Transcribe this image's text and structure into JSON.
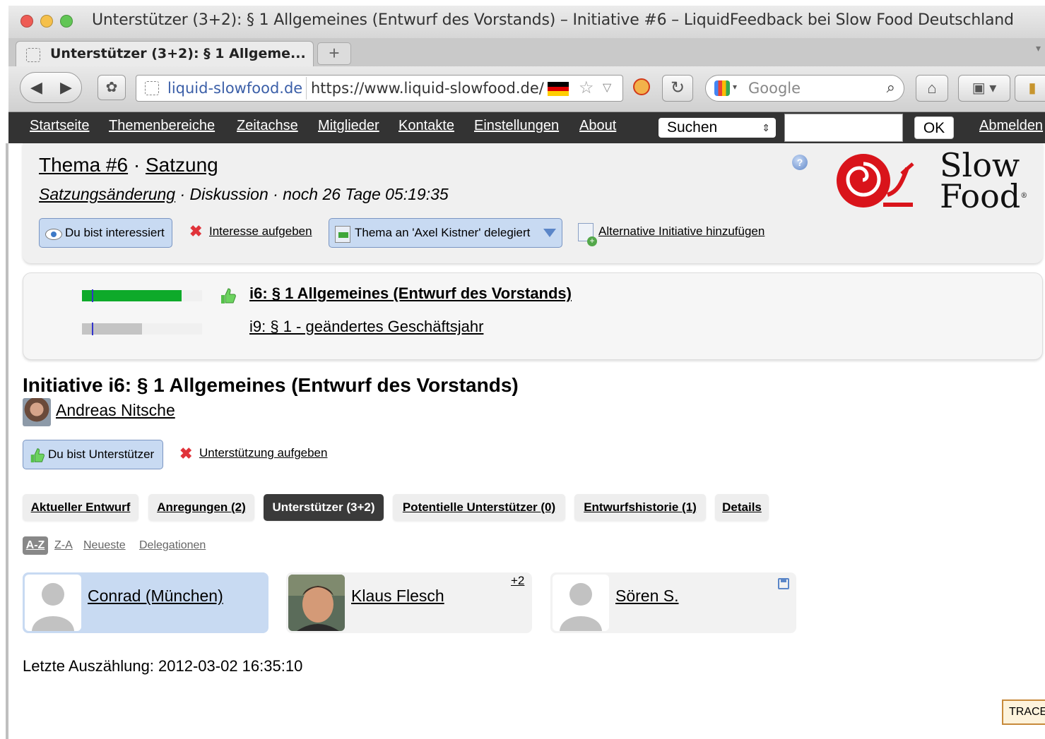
{
  "browser": {
    "window_title": "Unterstützer (3+2): § 1 Allgemeines (Entwurf des Vorstands) – Initiative #6 – LiquidFeedback bei Slow Food Deutschland",
    "tab_label": "Unterstützer (3+2): § 1 Allgeme...",
    "new_tab": "+",
    "url_host": "liquid-slowfood.de",
    "url_full": "https://www.liquid-slowfood.de/",
    "search_engine": "Google",
    "icons": [
      "back-icon",
      "forward-icon",
      "paw-icon",
      "star-icon",
      "noscript-icon",
      "reload-icon",
      "search-icon",
      "home-icon",
      "bookmarks-icon"
    ]
  },
  "sitenav": {
    "links": [
      "Startseite",
      "Themenbereiche",
      "Zeitachse",
      "Mitglieder",
      "Kontakte",
      "Einstellungen",
      "About"
    ],
    "search_select": "Suchen",
    "ok": "OK",
    "logout": "Abmelden"
  },
  "topic": {
    "title_prefix": "Thema #6",
    "separator": "·",
    "area": "Satzung",
    "policy": "Satzungsänderung",
    "state_text": "· Diskussion · noch 26 Tage 05:19:35",
    "btn_interested": "Du bist interessiert",
    "link_remove_interest": "Interesse aufgeben",
    "btn_delegated": "Thema an 'Axel Kistner' delegiert",
    "link_add_initiative": "Alternative Initiative hinzufügen"
  },
  "logo": {
    "line1": "Slow",
    "line2": "Food",
    "reg": "®",
    "color": "#d9141b"
  },
  "initiatives": [
    {
      "label": "i6: § 1 Allgemeines (Entwurf des Vorstands)",
      "bold": true,
      "supporter_fraction": 0.83,
      "bar_color": "#0eaa2a",
      "supported": true
    },
    {
      "label": "i9: § 1 - geändertes Geschäftsjahr",
      "bold": false,
      "supporter_fraction": 0.5,
      "bar_color": "#c4c4c4",
      "supported": false
    }
  ],
  "initiative": {
    "heading": "Initiative i6: § 1 Allgemeines (Entwurf des Vorstands)",
    "author": "Andreas Nitsche",
    "btn_supporter": "Du bist Unterstützer",
    "link_remove_support": "Unterstützung aufgeben"
  },
  "tabs": [
    {
      "label": "Aktueller Entwurf",
      "active": false
    },
    {
      "label": "Anregungen (2)",
      "active": false
    },
    {
      "label": "Unterstützer (3+2)",
      "active": true
    },
    {
      "label": "Potentielle Unterstützer (0)",
      "active": false
    },
    {
      "label": "Entwurfshistorie (1)",
      "active": false
    },
    {
      "label": "Details",
      "active": false
    }
  ],
  "sort": {
    "active": "A-Z",
    "options": [
      "Z-A",
      "Neueste",
      "Delegationen"
    ]
  },
  "members": [
    {
      "name": "Conrad (München)",
      "is_me": true,
      "weight": ""
    },
    {
      "name": "Klaus Flesch",
      "is_me": false,
      "weight": "+2"
    },
    {
      "name": "Sören S.",
      "is_me": false,
      "weight": ""
    }
  ],
  "last_count": "Letzte Auszählung: 2012-03-02 16:35:10",
  "trace": "TRACE"
}
